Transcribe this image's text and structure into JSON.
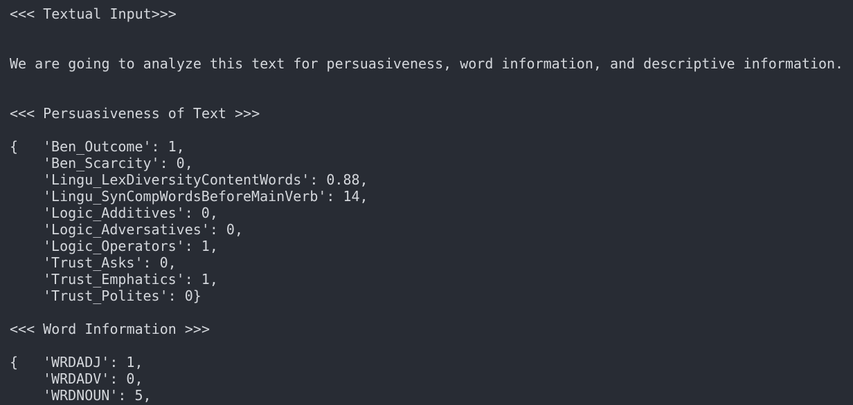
{
  "header_textual_input": "<<< Textual Input>>>",
  "input_text": "We are going to analyze this text for persuasiveness, word information, and descriptive information.",
  "header_persuasiveness": "<<< Persuasiveness of Text >>>",
  "persuasiveness": {
    "open_brace": "{",
    "lines": [
      "'Ben_Outcome': 1,",
      "'Ben_Scarcity': 0,",
      "'Lingu_LexDiversityContentWords': 0.88,",
      "'Lingu_SynCompWordsBeforeMainVerb': 14,",
      "'Logic_Additives': 0,",
      "'Logic_Adversatives': 0,",
      "'Logic_Operators': 1,",
      "'Trust_Asks': 0,",
      "'Trust_Emphatics': 1,",
      "'Trust_Polites': 0}"
    ]
  },
  "header_word_information": "<<< Word Information >>>",
  "word_information": {
    "open_brace": "{",
    "lines": [
      "'WRDADJ': 1,",
      "'WRDADV': 0,",
      "'WRDNOUN': 5,"
    ]
  }
}
